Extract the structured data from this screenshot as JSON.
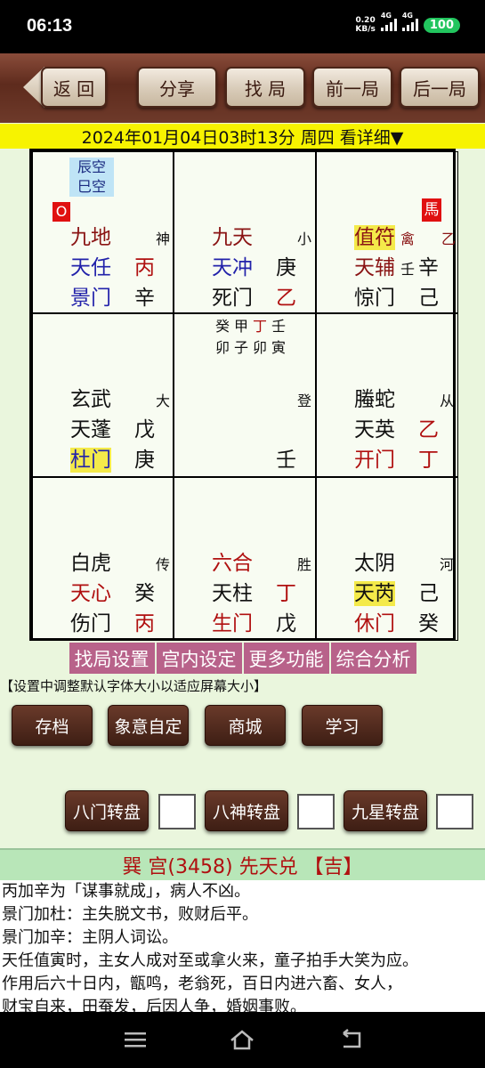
{
  "status": {
    "time": "06:13",
    "speed_top": "0.20",
    "speed_unit": "KB/s",
    "net1": "4G",
    "net2": "4G",
    "battery": "100"
  },
  "toolbar": {
    "back": "返 回",
    "share": "分享",
    "find": "找 局",
    "prev": "前一局",
    "next": "后一局"
  },
  "dateline": "2024年01月04日03时13分 周四 看详细▼",
  "palaces": [
    {
      "kong1": "辰空",
      "kong2": "巳空",
      "marker": "O",
      "god": "九地",
      "god_tag": "神",
      "star": "天任",
      "star_stem": "丙",
      "gate": "景门",
      "gate_stem": "辛"
    },
    {
      "god": "九天",
      "god_tag": "小",
      "star": "天冲",
      "star_stem": "庚",
      "gate": "死门",
      "gate_stem": "乙"
    },
    {
      "marker": "馬",
      "god": "值符",
      "god_tag": "禽",
      "god_tag2": "乙",
      "star": "天辅",
      "star_stem_small": "壬",
      "star_stem": "辛",
      "gate": "惊门",
      "gate_stem": "己"
    },
    {
      "god": "玄武",
      "god_tag": "大",
      "star": "天蓬",
      "star_stem": "戊",
      "gate": "杜门",
      "gate_stem": "庚"
    },
    {
      "row1": [
        "癸",
        "甲",
        "丁",
        "壬"
      ],
      "row2": [
        "卯",
        "子",
        "卯",
        "寅"
      ],
      "tag": "登",
      "stem": "壬"
    },
    {
      "god": "螣蛇",
      "god_tag": "从",
      "star": "天英",
      "star_stem": "乙",
      "gate": "开门",
      "gate_stem": "丁"
    },
    {
      "god": "白虎",
      "god_tag": "传",
      "star": "天心",
      "star_stem": "癸",
      "gate": "伤门",
      "gate_stem": "丙"
    },
    {
      "god": "六合",
      "god_tag": "胜",
      "star": "天柱",
      "star_stem": "丁",
      "gate": "生门",
      "gate_stem": "戊"
    },
    {
      "god": "太阴",
      "god_tag": "河",
      "star": "天芮",
      "star_stem": "己",
      "gate": "休门",
      "gate_stem": "癸"
    }
  ],
  "menu": [
    "找局设置",
    "宫内设定",
    "更多功能",
    "综合分析"
  ],
  "hint": "【设置中调整默认字体大小以适应屏幕大小】",
  "func_buttons": [
    "存档",
    "象意自定",
    "商城",
    "学习"
  ],
  "turn_buttons": [
    "八门转盘",
    "八神转盘",
    "九星转盘"
  ],
  "panel_title": "巽 宫(3458) 先天兑 【吉】",
  "detail_lines": [
    "丙加辛为「谋事就成」，病人不凶。",
    "景门加杜：主失脱文书，败财后平。",
    "景门加辛：主阴人词讼。",
    "天任值寅时，主女人成对至或拿火来，童子拍手大笑为应。",
    "作用后六十日内，甑鸣，老翁死，百日内进六畜、女人，",
    "财宝自来，田蚕发，后因人争，婚姻事败。"
  ],
  "colors": {
    "accent_red": "#b01010",
    "highlight": "#f4ea4a",
    "menu": "#b8628a",
    "toolbar": "#5e2b1d"
  }
}
